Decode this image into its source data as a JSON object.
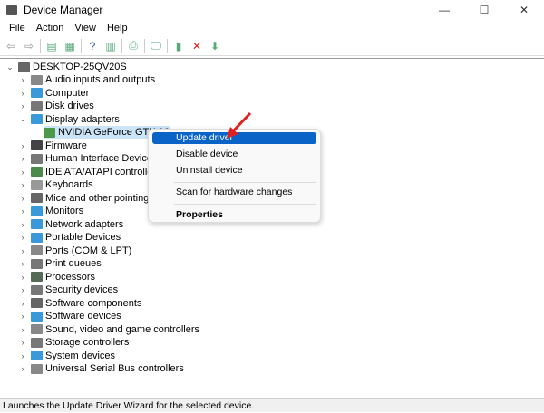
{
  "window": {
    "title": "Device Manager",
    "minimize": "—",
    "maximize": "☐",
    "close": "✕"
  },
  "menu": [
    "File",
    "Action",
    "View",
    "Help"
  ],
  "toolbar": [
    {
      "icon": "back-icon",
      "g": "⇦"
    },
    {
      "icon": "forward-icon",
      "g": "⇨"
    },
    {
      "icon": "properties-pane-icon",
      "g": "▤"
    },
    {
      "icon": "show-hidden-icon",
      "g": "▦"
    },
    {
      "icon": "help-icon",
      "g": "?"
    },
    {
      "icon": "action-pane-icon",
      "g": "▥"
    },
    {
      "icon": "print-icon",
      "g": "⎙"
    },
    {
      "icon": "scan-hardware-icon",
      "g": "🖵"
    },
    {
      "icon": "update-driver-icon",
      "g": "▮"
    },
    {
      "icon": "uninstall-icon",
      "g": "✕"
    },
    {
      "icon": "download-icon",
      "g": "⬇"
    }
  ],
  "tree": {
    "root": "DESKTOP-25QV20S",
    "items": [
      {
        "label": "Audio inputs and outputs",
        "color": "#888"
      },
      {
        "label": "Computer",
        "color": "#3a9ad9"
      },
      {
        "label": "Disk drives",
        "color": "#777"
      },
      {
        "label": "Display adapters",
        "color": "#3a9ad9",
        "expanded": true
      },
      {
        "label": "NVIDIA GeForce GTX 16",
        "color": "#4a9a4a",
        "child": true
      },
      {
        "label": "Firmware",
        "color": "#444"
      },
      {
        "label": "Human Interface Devices",
        "color": "#777"
      },
      {
        "label": "IDE ATA/ATAPI controllers",
        "color": "#4a8a4a"
      },
      {
        "label": "Keyboards",
        "color": "#999"
      },
      {
        "label": "Mice and other pointing de",
        "color": "#666"
      },
      {
        "label": "Monitors",
        "color": "#3a9ad9"
      },
      {
        "label": "Network adapters",
        "color": "#3a9ad9"
      },
      {
        "label": "Portable Devices",
        "color": "#3a9ad9"
      },
      {
        "label": "Ports (COM & LPT)",
        "color": "#888"
      },
      {
        "label": "Print queues",
        "color": "#777"
      },
      {
        "label": "Processors",
        "color": "#556b55"
      },
      {
        "label": "Security devices",
        "color": "#777"
      },
      {
        "label": "Software components",
        "color": "#666"
      },
      {
        "label": "Software devices",
        "color": "#3a9ad9"
      },
      {
        "label": "Sound, video and game controllers",
        "color": "#888"
      },
      {
        "label": "Storage controllers",
        "color": "#777"
      },
      {
        "label": "System devices",
        "color": "#3a9ad9"
      },
      {
        "label": "Universal Serial Bus controllers",
        "color": "#888"
      }
    ]
  },
  "context_menu": {
    "update": "Update driver",
    "disable": "Disable device",
    "uninstall": "Uninstall device",
    "scan": "Scan for hardware changes",
    "properties": "Properties"
  },
  "status": "Launches the Update Driver Wizard for the selected device.",
  "colors": {
    "highlight": "#0a64c8",
    "arrow": "#e02020"
  }
}
